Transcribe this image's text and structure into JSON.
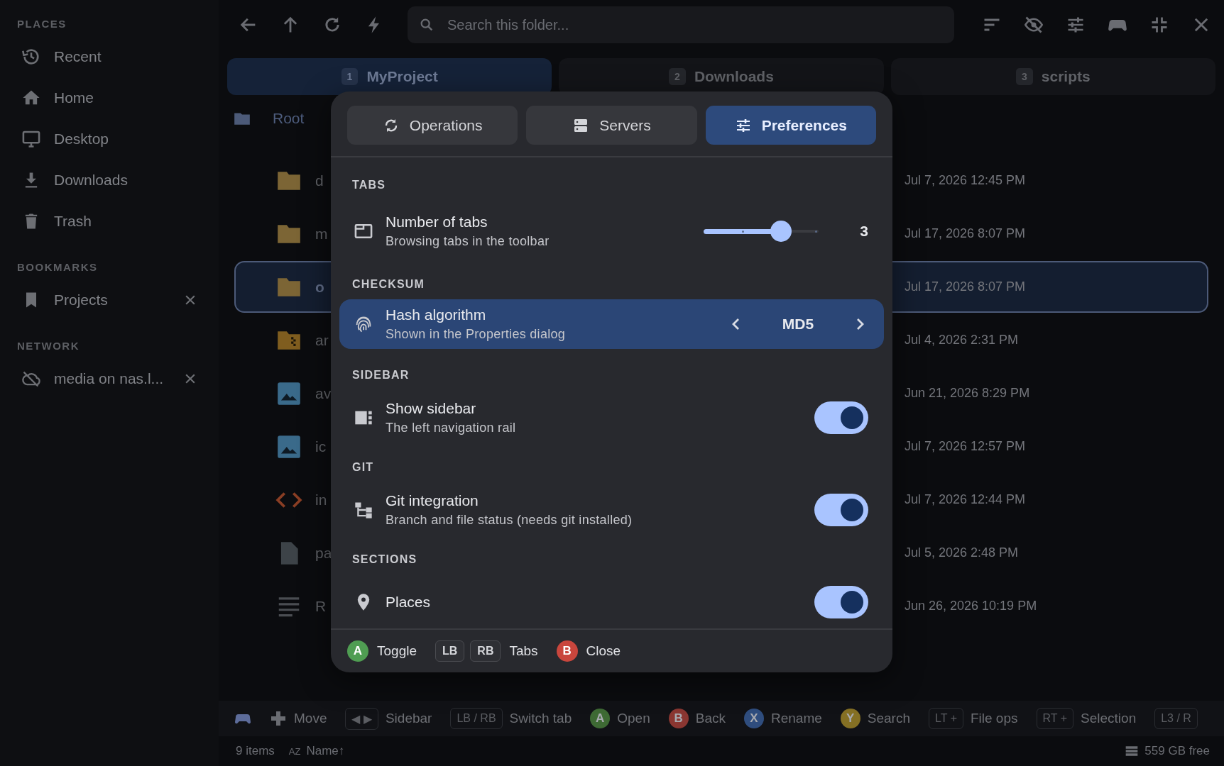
{
  "sidebar": {
    "sections": [
      {
        "title": "PLACES",
        "items": [
          {
            "label": "Recent",
            "removable": false
          },
          {
            "label": "Home",
            "removable": false
          },
          {
            "label": "Desktop",
            "removable": false
          },
          {
            "label": "Downloads",
            "removable": false
          },
          {
            "label": "Trash",
            "removable": false
          }
        ]
      },
      {
        "title": "BOOKMARKS",
        "items": [
          {
            "label": "Projects",
            "removable": true
          }
        ]
      },
      {
        "title": "NETWORK",
        "items": [
          {
            "label": "media on nas.l...",
            "removable": true
          }
        ]
      }
    ]
  },
  "toolbar": {
    "search": {
      "placeholder": "Search this folder..."
    }
  },
  "tabs": [
    {
      "number": "1",
      "label": "MyProject",
      "selected": true
    },
    {
      "number": "2",
      "label": "Downloads",
      "selected": false
    },
    {
      "number": "3",
      "label": "scripts",
      "selected": false
    }
  ],
  "breadcrumb": {
    "label": "Root"
  },
  "files": [
    {
      "kind": "folder",
      "name": "d",
      "date": "Jul 7, 2026 12:45 PM",
      "selected": false
    },
    {
      "kind": "folder",
      "name": "m",
      "date": "Jul 17, 2026 8:07 PM",
      "selected": false
    },
    {
      "kind": "folder",
      "name": "o",
      "date": "Jul 17, 2026 8:07 PM",
      "selected": true
    },
    {
      "kind": "archive",
      "name": "ar",
      "date": "Jul 4, 2026 2:31 PM",
      "selected": false
    },
    {
      "kind": "image",
      "name": "av",
      "date": "Jun 21, 2026 8:29 PM",
      "selected": false
    },
    {
      "kind": "image",
      "name": "ic",
      "date": "Jul 7, 2026 12:57 PM",
      "selected": false
    },
    {
      "kind": "code",
      "name": "in",
      "date": "Jul 7, 2026 12:44 PM",
      "selected": false
    },
    {
      "kind": "file",
      "name": "pa",
      "date": "Jul 5, 2026 2:48 PM",
      "selected": false
    },
    {
      "kind": "text",
      "name": "R",
      "date": "Jun 26, 2026 10:19 PM",
      "selected": false
    }
  ],
  "dialog": {
    "tabs": [
      {
        "label": "Operations",
        "selected": false
      },
      {
        "label": "Servers",
        "selected": false
      },
      {
        "label": "Preferences",
        "selected": true
      }
    ],
    "sections": [
      {
        "title": "TABS",
        "rows": [
          {
            "kind": "slider",
            "label": "Number of tabs",
            "description": "Browsing tabs in the toolbar",
            "level": 0.67,
            "reading": "3",
            "selected": false
          }
        ]
      },
      {
        "title": "CHECKSUM",
        "rows": [
          {
            "kind": "choice",
            "label": "Hash algorithm",
            "description": "Shown in the Properties dialog",
            "value": "MD5",
            "selected": true
          }
        ]
      },
      {
        "title": "SIDEBAR",
        "rows": [
          {
            "kind": "toggle",
            "label": "Show sidebar",
            "description": "The left navigation rail",
            "on": true,
            "selected": false
          }
        ]
      },
      {
        "title": "GIT",
        "rows": [
          {
            "kind": "toggle",
            "label": "Git integration",
            "description": "Branch and file status (needs git installed)",
            "on": true,
            "selected": false
          }
        ]
      },
      {
        "title": "SECTIONS",
        "rows": [
          {
            "kind": "toggle",
            "label": "Places",
            "on": true,
            "selected": false
          }
        ]
      }
    ],
    "footer": [
      {
        "kind": "button",
        "key": "A",
        "color": "#4f9d52",
        "label": "Toggle"
      },
      {
        "kind": "keys",
        "keys": [
          "LB",
          "RB"
        ],
        "label": "Tabs"
      },
      {
        "kind": "button",
        "key": "B",
        "color": "#c9463d",
        "label": "Close"
      }
    ]
  },
  "hints": [
    {
      "kind": "gamepad"
    },
    {
      "kind": "dpad",
      "label": "Move"
    },
    {
      "kind": "key",
      "key": "◀ ▶",
      "label": "Sidebar"
    },
    {
      "kind": "key",
      "key": "LB / RB",
      "label": "Switch tab"
    },
    {
      "kind": "button",
      "key": "A",
      "color": "#3e6a34",
      "label": "Open"
    },
    {
      "kind": "button",
      "key": "B",
      "color": "#8a3631",
      "label": "Back"
    },
    {
      "kind": "button",
      "key": "X",
      "color": "#2f4d7e",
      "label": "Rename"
    },
    {
      "kind": "button",
      "key": "Y",
      "color": "#857024",
      "label": "Search"
    },
    {
      "kind": "key",
      "key": "LT +",
      "label": "File ops"
    },
    {
      "kind": "key",
      "key": "RT +",
      "label": "Selection"
    },
    {
      "kind": "key",
      "key": "L3 / R"
    }
  ],
  "status_bar": {
    "count": "9 items",
    "sort_glyph": "AZ",
    "sort": "Name↑",
    "free": "559 GB free"
  }
}
